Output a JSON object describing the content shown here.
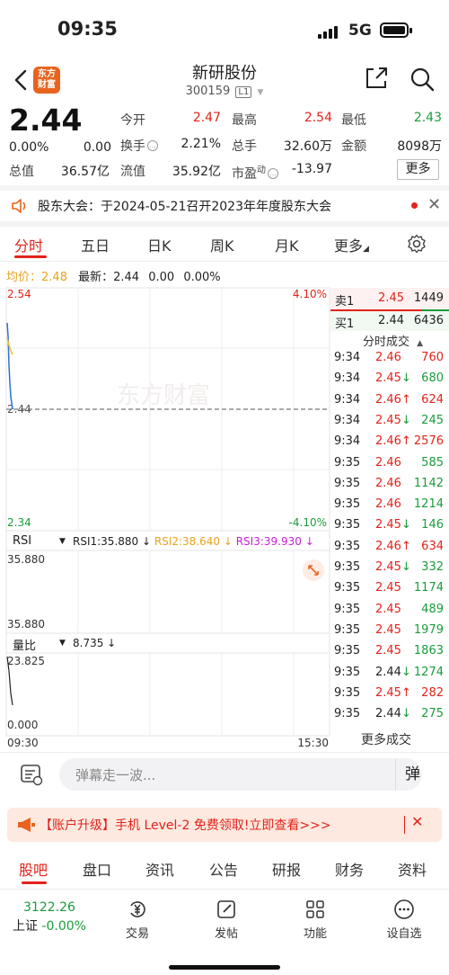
{
  "status_bar": {
    "time": "09:35",
    "network": "5G"
  },
  "header": {
    "logo_text": "东方财富",
    "stock_name": "新研股份",
    "stock_code": "300159",
    "level": "L1"
  },
  "quote": {
    "price": "2.44",
    "change_pct": "0.00%",
    "change_amt": "0.00",
    "fields": [
      {
        "label": "今开",
        "value": "2.47",
        "color": "red"
      },
      {
        "label": "最高",
        "value": "2.54",
        "color": "red"
      },
      {
        "label": "最低",
        "value": "2.43",
        "color": "green"
      },
      {
        "label": "换手",
        "value": "2.21%",
        "color": "black"
      },
      {
        "label": "总手",
        "value": "32.60万",
        "color": "black"
      },
      {
        "label": "金额",
        "value": "8098万",
        "color": "black"
      },
      {
        "label": "总值",
        "value": "36.57亿",
        "color": "black"
      },
      {
        "label": "流值",
        "value": "35.92亿",
        "color": "black"
      },
      {
        "label": "市盈",
        "value": "-13.97",
        "color": "black"
      }
    ],
    "pe_superscript": "动",
    "more_label": "更多"
  },
  "notice": {
    "text": "股东大会：于2024-05-21召开2023年年度股东大会"
  },
  "tabs": [
    "分时",
    "五日",
    "日K",
    "周K",
    "月K",
    "更多"
  ],
  "chart": {
    "avg_label": "均价：",
    "avg_value": "2.48",
    "latest_label": "最新：",
    "latest_value": "2.44",
    "latest_change": "0.00",
    "latest_pct": "0.00%",
    "price_high": "2.54",
    "price_mid": "2.44",
    "price_low": "2.34",
    "pct_high": "4.10%",
    "pct_low": "-4.10%",
    "watermark": "东方财富",
    "rsi_selector": "RSI",
    "rsi1": "RSI1:35.880 ↓",
    "rsi2": "RSI2:38.640 ↓",
    "rsi3": "RSI3:39.930 ↓",
    "rsi_top": "35.880",
    "rsi_bottom": "35.880",
    "vol_selector": "量比",
    "vol_value": "8.735 ↓",
    "vol_top": "23.825",
    "vol_bottom": "0.000",
    "time_start": "09:30",
    "time_end": "15:30"
  },
  "order_book": {
    "sell_label": "卖1",
    "sell_price": "2.45",
    "sell_vol": "1449",
    "buy_label": "买1",
    "buy_price": "2.44",
    "buy_vol": "6436",
    "trades_header": "分时成交",
    "more_trades": "更多成交",
    "trades": [
      {
        "time": "9:34",
        "price": "2.46",
        "arrow": "",
        "vol": "760",
        "pc": "red",
        "vc": "red"
      },
      {
        "time": "9:34",
        "price": "2.45",
        "arrow": "↓",
        "vol": "680",
        "pc": "red",
        "vc": "green"
      },
      {
        "time": "9:34",
        "price": "2.46",
        "arrow": "↑",
        "vol": "624",
        "pc": "red",
        "vc": "red"
      },
      {
        "time": "9:34",
        "price": "2.45",
        "arrow": "↓",
        "vol": "245",
        "pc": "red",
        "vc": "green"
      },
      {
        "time": "9:34",
        "price": "2.46",
        "arrow": "↑",
        "vol": "2576",
        "pc": "red",
        "vc": "red"
      },
      {
        "time": "9:35",
        "price": "2.46",
        "arrow": "",
        "vol": "585",
        "pc": "red",
        "vc": "green"
      },
      {
        "time": "9:35",
        "price": "2.46",
        "arrow": "",
        "vol": "1142",
        "pc": "red",
        "vc": "green"
      },
      {
        "time": "9:35",
        "price": "2.46",
        "arrow": "",
        "vol": "1214",
        "pc": "red",
        "vc": "green"
      },
      {
        "time": "9:35",
        "price": "2.45",
        "arrow": "↓",
        "vol": "146",
        "pc": "red",
        "vc": "green"
      },
      {
        "time": "9:35",
        "price": "2.46",
        "arrow": "↑",
        "vol": "634",
        "pc": "red",
        "vc": "red"
      },
      {
        "time": "9:35",
        "price": "2.45",
        "arrow": "↓",
        "vol": "332",
        "pc": "red",
        "vc": "green"
      },
      {
        "time": "9:35",
        "price": "2.45",
        "arrow": "",
        "vol": "1174",
        "pc": "red",
        "vc": "green"
      },
      {
        "time": "9:35",
        "price": "2.45",
        "arrow": "",
        "vol": "489",
        "pc": "red",
        "vc": "green"
      },
      {
        "time": "9:35",
        "price": "2.45",
        "arrow": "",
        "vol": "1979",
        "pc": "red",
        "vc": "green"
      },
      {
        "time": "9:35",
        "price": "2.45",
        "arrow": "",
        "vol": "1863",
        "pc": "red",
        "vc": "green"
      },
      {
        "time": "9:35",
        "price": "2.44",
        "arrow": "↓",
        "vol": "1274",
        "pc": "black",
        "vc": "green"
      },
      {
        "time": "9:35",
        "price": "2.45",
        "arrow": "↑",
        "vol": "282",
        "pc": "red",
        "vc": "red"
      },
      {
        "time": "9:35",
        "price": "2.44",
        "arrow": "↓",
        "vol": "275",
        "pc": "black",
        "vc": "green"
      }
    ]
  },
  "danmaku": {
    "placeholder": "弹幕走一波...",
    "send_label": "弹"
  },
  "banner": {
    "text": "【账户升级】手机 Level-2 免费领取!立即查看>>>"
  },
  "bottom_tabs": [
    "股吧",
    "盘口",
    "资讯",
    "公告",
    "研报",
    "财务",
    "资料"
  ],
  "footer": {
    "index_value": "3122.26",
    "index_label": "上证",
    "index_change": "-0.00%",
    "items": [
      "交易",
      "发帖",
      "功能",
      "设自选"
    ]
  },
  "colors": {
    "up": "#e2231a",
    "down": "#1a9c3c",
    "accent": "#e2231a",
    "brand": "#e8641e"
  }
}
